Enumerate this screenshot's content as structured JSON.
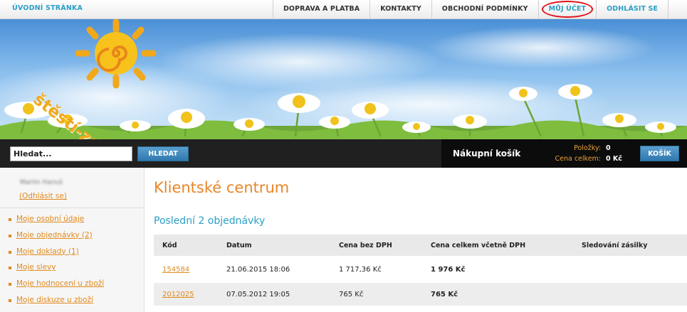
{
  "topnav": {
    "home": "ÚVODNÍ STRÁNKA",
    "links": [
      "DOPRAVA A PLATBA",
      "KONTAKTY",
      "OBCHODNÍ PODMÍNKY",
      "MŮJ ÚČET",
      "ODHLÁSIT SE"
    ]
  },
  "banner": {
    "logo_text": "štěstí-zdraví.cz"
  },
  "search": {
    "value": "Hledat...",
    "button": "HLEDAT"
  },
  "cart": {
    "title": "Nákupní košík",
    "items_label": "Položky:",
    "items_value": "0",
    "total_label": "Cena celkem:",
    "total_value": "0 Kč",
    "button": "KOŠÍK"
  },
  "sidebar": {
    "user_name": "Martin Hanuš",
    "logout": "(Odhlásit se)",
    "items": [
      "Moje osobní údaje",
      "Moje objednávky (2)",
      "Moje doklady (1)",
      "Moje slevy",
      "Moje hodnocení u zboží",
      "Moje diskuze u zboží"
    ]
  },
  "main": {
    "title": "Klientské centrum",
    "section": "Poslední 2 objednávky",
    "columns": [
      "Kód",
      "Datum",
      "Cena bez DPH",
      "Cena celkem včetně DPH",
      "Sledování zásilky"
    ],
    "rows": [
      {
        "code": "154584",
        "date": "21.06.2015 18:06",
        "net": "1 717,36 Kč",
        "total": "1 976 Kč",
        "tracking": ""
      },
      {
        "code": "2012025",
        "date": "07.05.2012 19:05",
        "net": "765 Kč",
        "total": "765 Kč",
        "tracking": ""
      }
    ]
  },
  "colors": {
    "accent_blue": "#2a9fc6",
    "accent_orange": "#e8862a",
    "highlight_circle": "#e0101a"
  }
}
